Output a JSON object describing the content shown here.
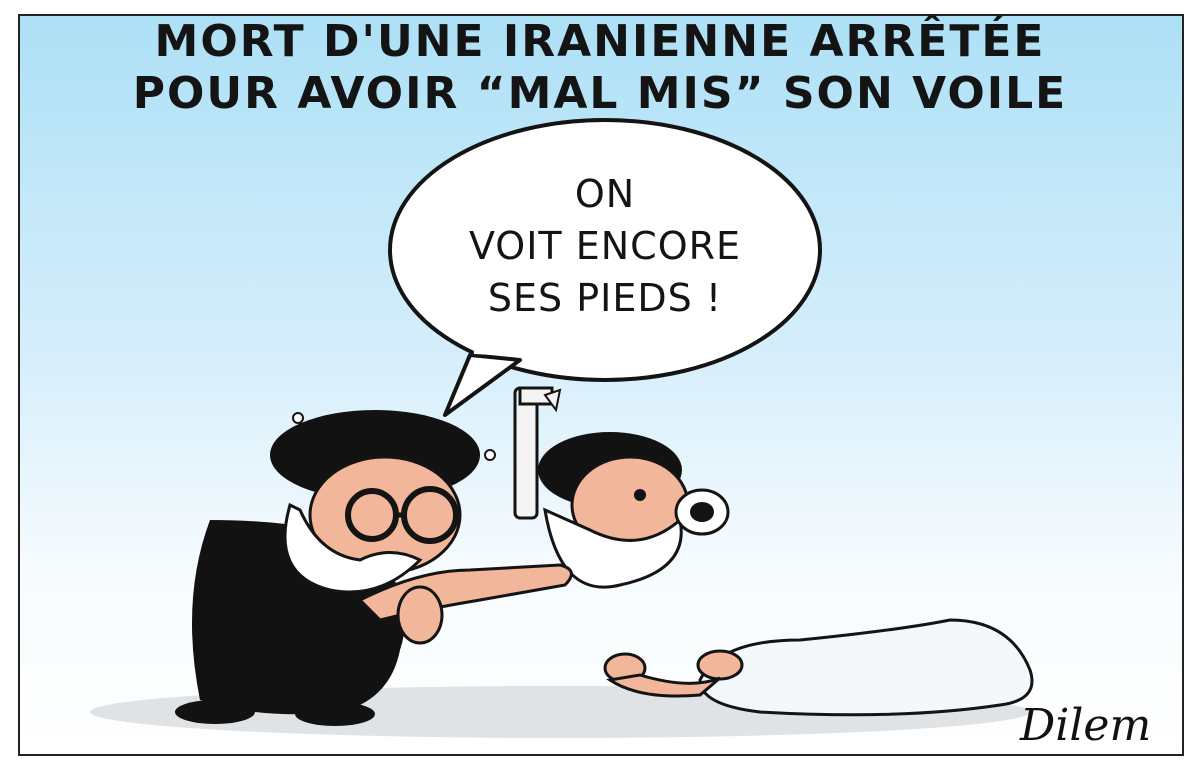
{
  "cartoon": {
    "title_line1": "MORT D'UNE IRANIENNE ARRÊTÉE",
    "title_line2": "POUR AVOIR “MAL MIS” SON VOILE",
    "speech_line1": "ON",
    "speech_line2": "VOIT ENCORE",
    "speech_line3": "SES PIEDS !",
    "signature": "Dilem"
  },
  "colors": {
    "sky_top": "#ade0f6",
    "robe": "#111111",
    "beard": "#ffffff",
    "skin": "#f2b79b",
    "shroud": "#f4f8fb"
  }
}
